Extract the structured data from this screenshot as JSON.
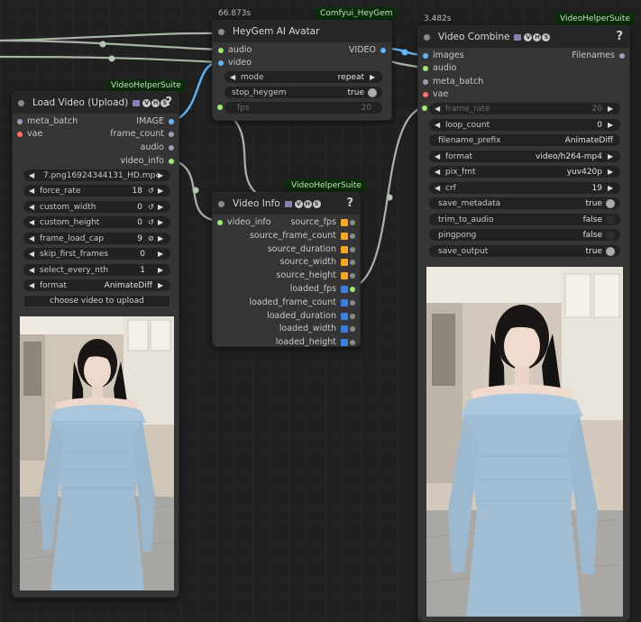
{
  "colors": {
    "image": "#64b5f6",
    "audio": "#a1e87a",
    "vae": "#ff6e6e",
    "latent": "#9aa0b6",
    "float": "#f5a623",
    "int": "#3a7fdd",
    "wire": "#b7c6b4",
    "tag_bg": "#0b2b0b"
  },
  "heygem": {
    "title": "HeyGem AI Avatar",
    "time": "66.873s",
    "tag": "Comfyui_HeyGem",
    "inputs": {
      "audio": "audio",
      "video": "video"
    },
    "outputs": {
      "video": "VIDEO"
    },
    "widgets": {
      "mode": {
        "label": "mode",
        "value": "repeat"
      },
      "stop_heygem": {
        "label": "stop_heygem",
        "value": "true"
      },
      "fps": {
        "label": "fps",
        "value": "20"
      }
    }
  },
  "load_video": {
    "title": "Load Video (Upload)",
    "tag": "VideoHelperSuite",
    "help": "?",
    "inputs": {
      "meta_batch": "meta_batch",
      "vae": "vae"
    },
    "outputs": {
      "image": "IMAGE",
      "frame_count": "frame_count",
      "audio": "audio",
      "video_info": "video_info"
    },
    "widgets": {
      "video": {
        "label": "",
        "value": "7.png16924344131_HD.mp4"
      },
      "force_rate": {
        "label": "force_rate",
        "value": "18"
      },
      "custom_width": {
        "label": "custom_width",
        "value": "0"
      },
      "custom_height": {
        "label": "custom_height",
        "value": "0"
      },
      "frame_load_cap": {
        "label": "frame_load_cap",
        "value": "9"
      },
      "skip_first_frames": {
        "label": "skip_first_frames",
        "value": "0"
      },
      "select_every_nth": {
        "label": "select_every_nth",
        "value": "1"
      },
      "format": {
        "label": "format",
        "value": "AnimateDiff"
      }
    },
    "upload_label": "choose video to upload"
  },
  "video_info": {
    "title": "Video Info",
    "tag": "VideoHelperSuite",
    "help": "?",
    "inputs": {
      "video_info": "video_info"
    },
    "outputs": [
      {
        "label": "source_fps",
        "kind": "float"
      },
      {
        "label": "source_frame_count",
        "kind": "float"
      },
      {
        "label": "source_duration",
        "kind": "float"
      },
      {
        "label": "source_width",
        "kind": "float"
      },
      {
        "label": "source_height",
        "kind": "float"
      },
      {
        "label": "loaded_fps",
        "kind": "int"
      },
      {
        "label": "loaded_frame_count",
        "kind": "int"
      },
      {
        "label": "loaded_duration",
        "kind": "int"
      },
      {
        "label": "loaded_width",
        "kind": "int"
      },
      {
        "label": "loaded_height",
        "kind": "int"
      }
    ]
  },
  "video_combine": {
    "title": "Video Combine",
    "time": "3.482s",
    "tag": "VideoHelperSuite",
    "help": "?",
    "inputs": {
      "images": "images",
      "audio": "audio",
      "meta_batch": "meta_batch",
      "vae": "vae"
    },
    "outputs": {
      "filenames": "Filenames"
    },
    "widgets": {
      "frame_rate": {
        "label": "frame_rate",
        "value": "20"
      },
      "loop_count": {
        "label": "loop_count",
        "value": "0"
      },
      "filename_prefix": {
        "label": "filename_prefix",
        "value": "AnimateDiff"
      },
      "format": {
        "label": "format",
        "value": "video/h264-mp4"
      },
      "pix_fmt": {
        "label": "pix_fmt",
        "value": "yuv420p"
      },
      "crf": {
        "label": "crf",
        "value": "19"
      },
      "save_metadata": {
        "label": "save_metadata",
        "value": "true"
      },
      "trim_to_audio": {
        "label": "trim_to_audio",
        "value": "false"
      },
      "pingpong": {
        "label": "pingpong",
        "value": "false"
      },
      "save_output": {
        "label": "save_output",
        "value": "true"
      }
    }
  }
}
